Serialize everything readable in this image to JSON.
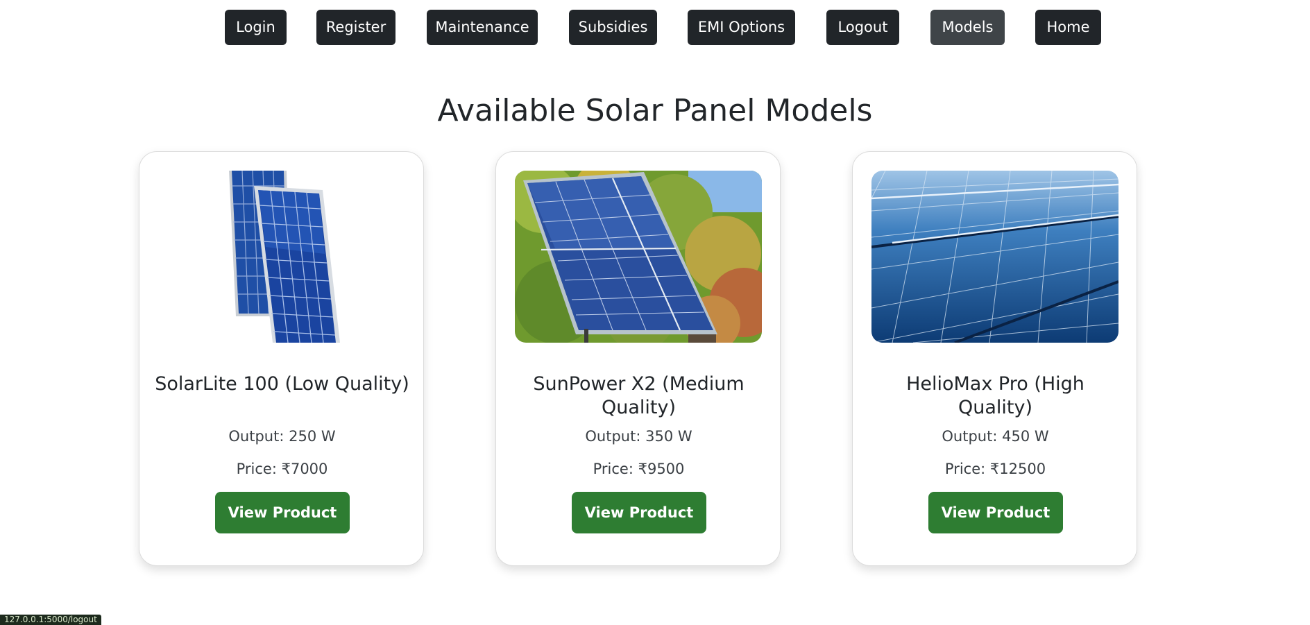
{
  "nav": {
    "items": [
      {
        "label": "Login"
      },
      {
        "label": "Register"
      },
      {
        "label": "Maintenance"
      },
      {
        "label": "Subsidies"
      },
      {
        "label": "EMI Options"
      },
      {
        "label": "Logout"
      },
      {
        "label": "Models",
        "active": true
      },
      {
        "label": "Home"
      }
    ]
  },
  "page": {
    "title": "Available Solar Panel Models"
  },
  "products": [
    {
      "name": "SolarLite 100 (Low Quality)",
      "output_label": "Output:",
      "output_value": "250 W",
      "price_label": "Price:",
      "price_value": "₹7000",
      "button_label": "View Product",
      "image_icon": "solar-panel-pair-image"
    },
    {
      "name": "SunPower X2 (Medium Quality)",
      "output_label": "Output:",
      "output_value": "350 W",
      "price_label": "Price:",
      "price_value": "₹9500",
      "button_label": "View Product",
      "image_icon": "solar-panel-forest-image"
    },
    {
      "name": "HelioMax Pro (High Quality)",
      "output_label": "Output:",
      "output_value": "450 W",
      "price_label": "Price:",
      "price_value": "₹12500",
      "button_label": "View Product",
      "image_icon": "solar-panel-closeup-image"
    }
  ],
  "status_bar": {
    "url": "127.0.0.1:5000/logout"
  },
  "colors": {
    "nav_bg": "#212529",
    "nav_active_bg": "#3f4448",
    "button_green": "#2e7d32",
    "text_dark": "#212529"
  }
}
